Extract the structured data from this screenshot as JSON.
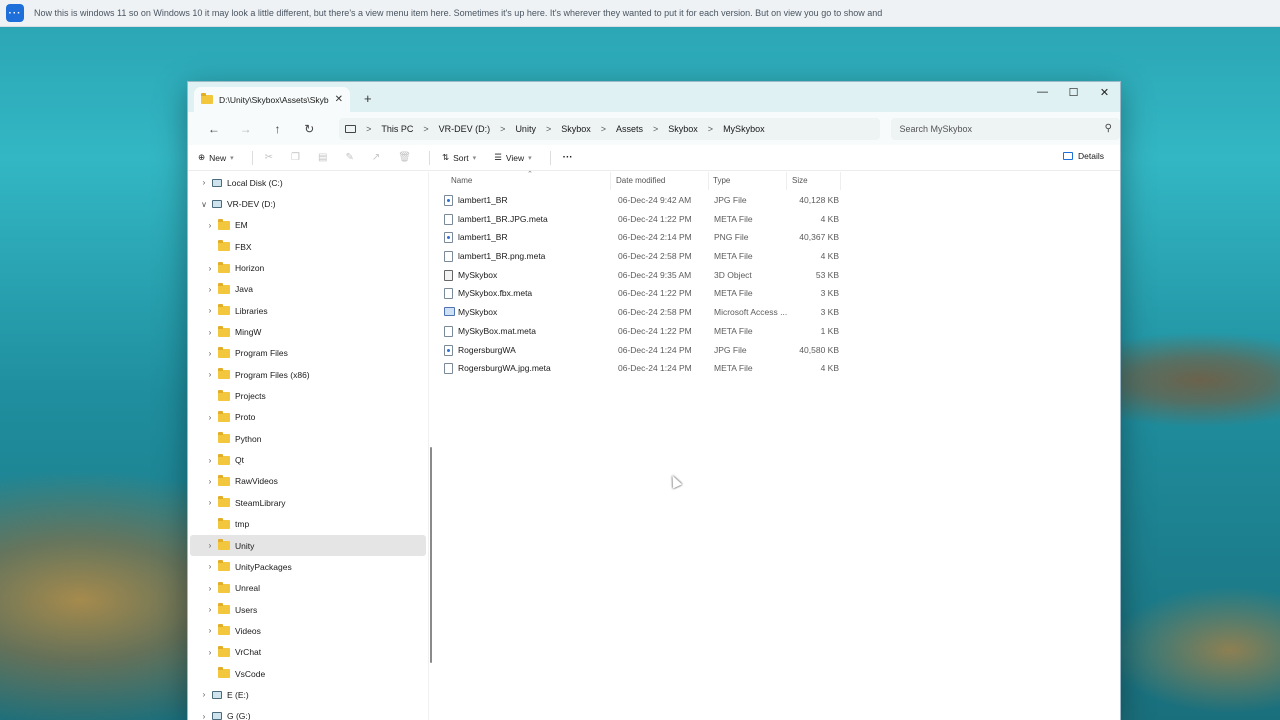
{
  "caption": {
    "text": "Now this is windows 11 so on Windows 10 it may look a little different, but there's a view menu item here. Sometimes it's up here. It's wherever they wanted to put it for each version. But on view you go to show and"
  },
  "window": {
    "tab_title": "D:\\Unity\\Skybox\\Assets\\Skybox",
    "tab_close": "✕",
    "new_tab": "+",
    "controls": {
      "minimize": "—",
      "maximize": "☐",
      "close": "✕"
    }
  },
  "nav": {
    "back": "←",
    "forward": "→",
    "up": "↑",
    "refresh": "↻",
    "breadcrumbs": [
      "This PC",
      "VR-DEV (D:)",
      "Unity",
      "Skybox",
      "Assets",
      "Skybox",
      "MySkybox"
    ],
    "separator": ">",
    "search_placeholder": "Search MySkybox"
  },
  "toolbar": {
    "new_label": "New",
    "sort_label": "Sort",
    "view_label": "View",
    "more_label": "···",
    "details_label": "Details"
  },
  "tree": [
    {
      "label": "Local Disk (C:)",
      "kind": "drive",
      "indent": 0,
      "chevron": ">"
    },
    {
      "label": "VR-DEV (D:)",
      "kind": "drive",
      "indent": 0,
      "chevron": "v"
    },
    {
      "label": "EM",
      "kind": "folder",
      "indent": 1,
      "chevron": ">"
    },
    {
      "label": "FBX",
      "kind": "folder",
      "indent": 1,
      "chevron": ""
    },
    {
      "label": "Horizon",
      "kind": "folder",
      "indent": 1,
      "chevron": ">"
    },
    {
      "label": "Java",
      "kind": "folder",
      "indent": 1,
      "chevron": ">"
    },
    {
      "label": "Libraries",
      "kind": "folder",
      "indent": 1,
      "chevron": ">"
    },
    {
      "label": "MingW",
      "kind": "folder",
      "indent": 1,
      "chevron": ">"
    },
    {
      "label": "Program Files",
      "kind": "folder",
      "indent": 1,
      "chevron": ">"
    },
    {
      "label": "Program Files (x86)",
      "kind": "folder",
      "indent": 1,
      "chevron": ">"
    },
    {
      "label": "Projects",
      "kind": "folder",
      "indent": 1,
      "chevron": ""
    },
    {
      "label": "Proto",
      "kind": "folder",
      "indent": 1,
      "chevron": ">"
    },
    {
      "label": "Python",
      "kind": "folder",
      "indent": 1,
      "chevron": ""
    },
    {
      "label": "Qt",
      "kind": "folder",
      "indent": 1,
      "chevron": ">"
    },
    {
      "label": "RawVideos",
      "kind": "folder",
      "indent": 1,
      "chevron": ">"
    },
    {
      "label": "SteamLibrary",
      "kind": "folder",
      "indent": 1,
      "chevron": ">"
    },
    {
      "label": "tmp",
      "kind": "folder",
      "indent": 1,
      "chevron": ""
    },
    {
      "label": "Unity",
      "kind": "folder",
      "indent": 1,
      "chevron": ">",
      "selected": true
    },
    {
      "label": "UnityPackages",
      "kind": "folder",
      "indent": 1,
      "chevron": ">"
    },
    {
      "label": "Unreal",
      "kind": "folder",
      "indent": 1,
      "chevron": ">"
    },
    {
      "label": "Users",
      "kind": "folder",
      "indent": 1,
      "chevron": ">"
    },
    {
      "label": "Videos",
      "kind": "folder",
      "indent": 1,
      "chevron": ">"
    },
    {
      "label": "VrChat",
      "kind": "folder",
      "indent": 1,
      "chevron": ">"
    },
    {
      "label": "VsCode",
      "kind": "folder",
      "indent": 1,
      "chevron": ""
    },
    {
      "label": "E (E:)",
      "kind": "drive",
      "indent": 0,
      "chevron": ">"
    },
    {
      "label": "G (G:)",
      "kind": "drive",
      "indent": 0,
      "chevron": ">"
    }
  ],
  "columns": {
    "name": "Name",
    "date": "Date modified",
    "type": "Type",
    "size": "Size"
  },
  "files": [
    {
      "name": "lambert1_BR",
      "date": "06-Dec-24 9:42 AM",
      "type": "JPG File",
      "size": "40,128 KB",
      "icon": "img"
    },
    {
      "name": "lambert1_BR.JPG.meta",
      "date": "06-Dec-24 1:22 PM",
      "type": "META File",
      "size": "4 KB",
      "icon": "doc"
    },
    {
      "name": "lambert1_BR",
      "date": "06-Dec-24 2:14 PM",
      "type": "PNG File",
      "size": "40,367 KB",
      "icon": "img"
    },
    {
      "name": "lambert1_BR.png.meta",
      "date": "06-Dec-24 2:58 PM",
      "type": "META File",
      "size": "4 KB",
      "icon": "doc"
    },
    {
      "name": "MySkybox",
      "date": "06-Dec-24 9:35 AM",
      "type": "3D Object",
      "size": "53 KB",
      "icon": "obj"
    },
    {
      "name": "MySkybox.fbx.meta",
      "date": "06-Dec-24 1:22 PM",
      "type": "META File",
      "size": "3 KB",
      "icon": "doc"
    },
    {
      "name": "MySkybox",
      "date": "06-Dec-24 2:58 PM",
      "type": "Microsoft Access ...",
      "size": "3 KB",
      "icon": "mat"
    },
    {
      "name": "MySkyBox.mat.meta",
      "date": "06-Dec-24 1:22 PM",
      "type": "META File",
      "size": "1 KB",
      "icon": "doc"
    },
    {
      "name": "RogersburgWA",
      "date": "06-Dec-24 1:24 PM",
      "type": "JPG File",
      "size": "40,580 KB",
      "icon": "img"
    },
    {
      "name": "RogersburgWA.jpg.meta",
      "date": "06-Dec-24 1:24 PM",
      "type": "META File",
      "size": "4 KB",
      "icon": "doc"
    }
  ]
}
